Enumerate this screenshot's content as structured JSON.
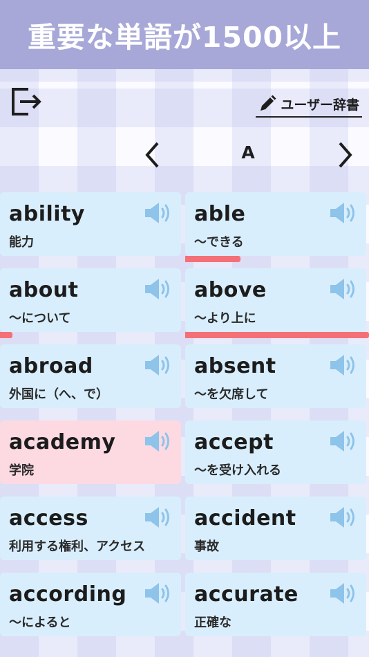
{
  "header": {
    "title": "重要な単語が1500以上"
  },
  "toolbar": {
    "exit_icon": "exit-icon",
    "dictionary_label": "ユーザー辞書",
    "dictionary_icon": "pencil-icon"
  },
  "letter_nav": {
    "current": "A",
    "prev_icon": "chevron-left-icon",
    "next_icon": "chevron-right-icon"
  },
  "colors": {
    "header": "#a7a8d8",
    "card": "#d9eefc",
    "card_selected": "#fdd9e2",
    "progress": "#f47077",
    "speaker": "#8ec3ea"
  },
  "words": [
    {
      "word": "ability",
      "meaning": "能力",
      "selected": false,
      "progress": 0
    },
    {
      "word": "able",
      "meaning": "〜できる",
      "selected": false,
      "progress": 0.3
    },
    {
      "word": "about",
      "meaning": "〜について",
      "selected": false,
      "progress": 0.07
    },
    {
      "word": "above",
      "meaning": "〜より上に",
      "selected": false,
      "progress": 1.0
    },
    {
      "word": "abroad",
      "meaning": "外国に（へ、で）",
      "selected": false,
      "progress": 0
    },
    {
      "word": "absent",
      "meaning": "〜を欠席して",
      "selected": false,
      "progress": 0
    },
    {
      "word": "academy",
      "meaning": "学院",
      "selected": true,
      "progress": 0
    },
    {
      "word": "accept",
      "meaning": "〜を受け入れる",
      "selected": false,
      "progress": 0
    },
    {
      "word": "access",
      "meaning": "利用する権利、アクセス",
      "selected": false,
      "progress": 0
    },
    {
      "word": "accident",
      "meaning": "事故",
      "selected": false,
      "progress": 0
    },
    {
      "word": "according",
      "meaning": "〜によると",
      "selected": false,
      "progress": 0
    },
    {
      "word": "accurate",
      "meaning": "正確な",
      "selected": false,
      "progress": 0
    }
  ]
}
